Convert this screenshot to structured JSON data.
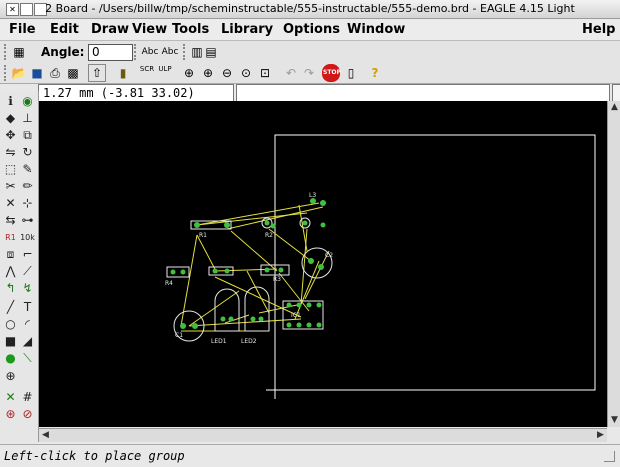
{
  "window": {
    "title": "2 Board - /Users/billw/tmp/scheminstructable/555-instructable/555-demo.brd - EAGLE 4.15 Light"
  },
  "menu": {
    "items": [
      "File",
      "Edit",
      "Draw",
      "View",
      "Tools",
      "Library",
      "Options",
      "Window"
    ],
    "help": "Help"
  },
  "toolbar1": {
    "angle_label": "Angle:",
    "angle_value": "0",
    "mirror_label": "Abc",
    "spin_label": "Abc"
  },
  "toolbar2": {
    "icons": [
      "open-icon",
      "save-icon",
      "print-icon",
      "cam-icon",
      "switch-to-schematic-icon",
      "library-icon",
      "script-icon",
      "ulp-icon",
      "zoom-fit-icon",
      "zoom-in-icon",
      "zoom-out-icon",
      "zoom-redraw-icon",
      "zoom-select-icon",
      "undo-icon",
      "redo-icon",
      "stop-icon",
      "go-icon",
      "help-icon"
    ]
  },
  "coord": {
    "display": "1.27 mm (-3.81 33.02)"
  },
  "command": {
    "value": ""
  },
  "status": {
    "text": "Left-click to place group"
  },
  "board": {
    "labels": [
      "L3",
      "R1",
      "R2",
      "LED1",
      "LED2",
      "R3",
      "C1",
      "IC1",
      "C2",
      "R4"
    ]
  },
  "colors": {
    "canvas": "#000000",
    "outline": "#ffffff",
    "airwire": "#e0e040",
    "pad": "#40c040",
    "silk": "#e8e8e8"
  }
}
